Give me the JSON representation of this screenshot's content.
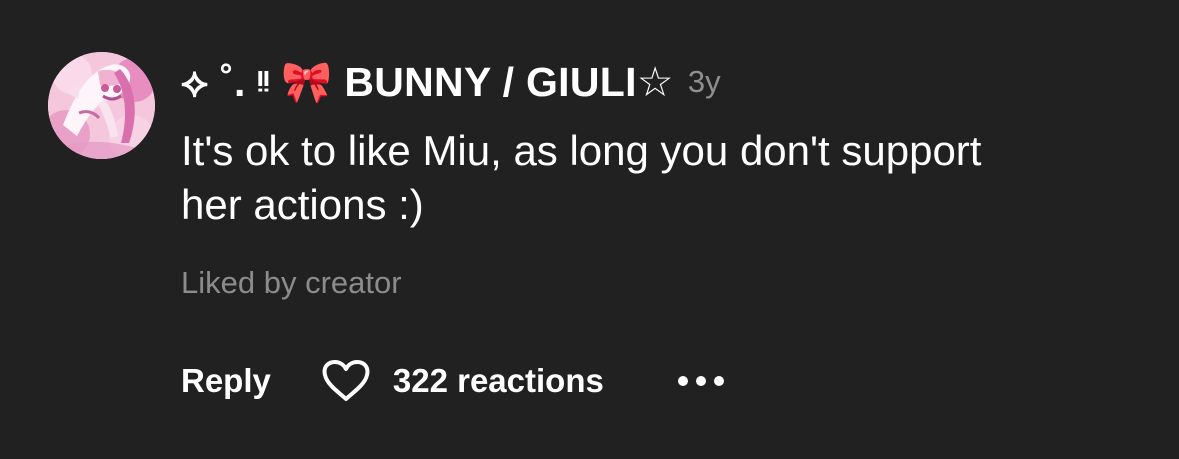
{
  "comment": {
    "author": "⟡ ˚. ᵎᵎ 🎀 BUNNY / GIULI☆",
    "timestamp": "3y",
    "text": "It's ok to like Miu, as long you don't support her actions :)",
    "liked_by": "Liked by creator"
  },
  "actions": {
    "reply_label": "Reply",
    "reactions_label": "322 reactions"
  },
  "icons": {
    "avatar": "pink-anime-avatar",
    "reaction": "heart-outline-icon",
    "more": "more-options-icon"
  },
  "colors": {
    "background": "#212121",
    "primary_text": "#ffffff",
    "secondary_text": "#8c8c8c"
  }
}
